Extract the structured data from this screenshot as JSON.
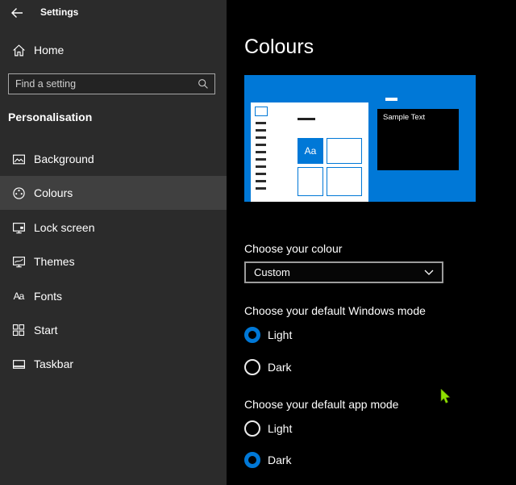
{
  "window": {
    "title": "Settings"
  },
  "sidebar": {
    "home_label": "Home",
    "search_placeholder": "Find a setting",
    "section_title": "Personalisation",
    "items": [
      {
        "label": "Background",
        "selected": false
      },
      {
        "label": "Colours",
        "selected": true
      },
      {
        "label": "Lock screen",
        "selected": false
      },
      {
        "label": "Themes",
        "selected": false
      },
      {
        "label": "Fonts",
        "selected": false
      },
      {
        "label": "Start",
        "selected": false
      },
      {
        "label": "Taskbar",
        "selected": false
      }
    ]
  },
  "main": {
    "title": "Colours",
    "preview": {
      "sample_text": "Sample Text",
      "aa_tile": "Aa"
    },
    "choose_colour": {
      "label": "Choose your colour",
      "selected_value": "Custom"
    },
    "windows_mode": {
      "label": "Choose your default Windows mode",
      "options": [
        {
          "label": "Light",
          "selected": true
        },
        {
          "label": "Dark",
          "selected": false
        }
      ]
    },
    "app_mode": {
      "label": "Choose your default app mode",
      "options": [
        {
          "label": "Light",
          "selected": false
        },
        {
          "label": "Dark",
          "selected": true
        }
      ]
    }
  },
  "icons": {
    "back": "arrow-left",
    "home": "house",
    "search": "magnifier",
    "background": "picture-frame",
    "colours": "palette",
    "lock_screen": "monitor-lock",
    "themes": "monitor-paintbrush",
    "fonts_glyph": "Aa",
    "start": "tile-grid",
    "taskbar": "monitor-taskbar",
    "dropdown_chevron": "chevron-down",
    "cursor": "green-arrow-pointer"
  },
  "colors": {
    "accent": "#0078d7",
    "sidebar_bg": "#2b2b2b",
    "selected_item_bg": "#404040",
    "main_bg": "#000000",
    "cursor": "#8ee000"
  }
}
